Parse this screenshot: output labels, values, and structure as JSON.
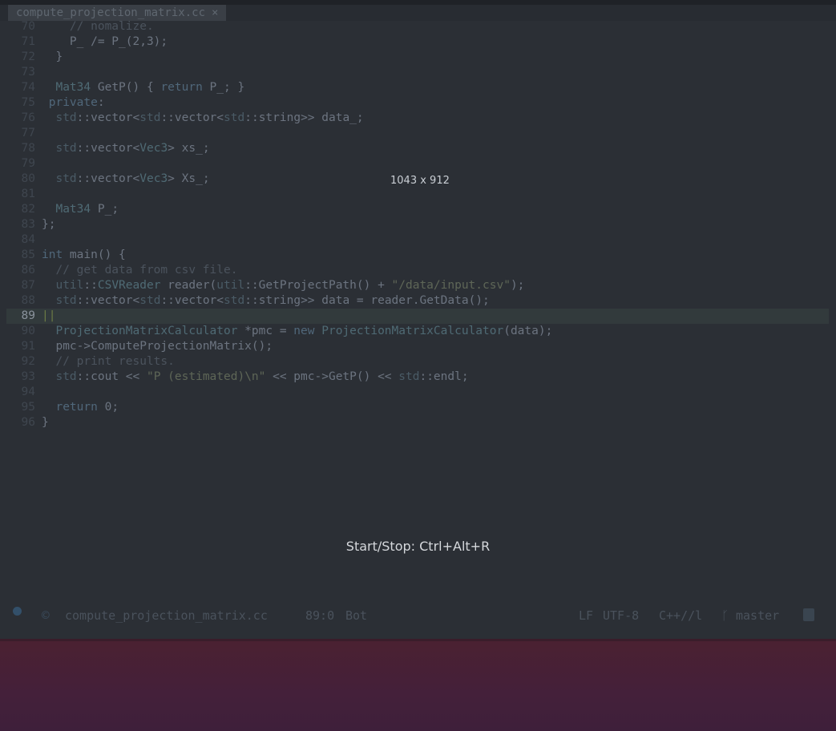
{
  "tab": {
    "filename": "compute_projection_matrix.cc",
    "close": "×"
  },
  "editor": {
    "current_line": 89,
    "lines": [
      {
        "n": "70",
        "html": "    <span class=\"c-com\">// nomalize.</span>"
      },
      {
        "n": "71",
        "html": "    P_ /= P_(2,3);"
      },
      {
        "n": "72",
        "html": "  }"
      },
      {
        "n": "73",
        "html": ""
      },
      {
        "n": "74",
        "html": "  <span class=\"c-type\">Mat34</span> GetP() { <span class=\"c-kw\">return</span> P_; }"
      },
      {
        "n": "75",
        "html": " <span class=\"c-kw\">private</span>:"
      },
      {
        "n": "76",
        "html": "  <span class=\"c-ns\">std</span>::vector&lt;<span class=\"c-ns\">std</span>::vector&lt;<span class=\"c-ns\">std</span>::string&gt;&gt; data_;"
      },
      {
        "n": "77",
        "html": ""
      },
      {
        "n": "78",
        "html": "  <span class=\"c-ns\">std</span>::vector&lt;<span class=\"c-type\">Vec3</span>&gt; xs_;"
      },
      {
        "n": "79",
        "html": ""
      },
      {
        "n": "80",
        "html": "  <span class=\"c-ns\">std</span>::vector&lt;<span class=\"c-type\">Vec3</span>&gt; Xs_;"
      },
      {
        "n": "81",
        "html": ""
      },
      {
        "n": "82",
        "html": "  <span class=\"c-type\">Mat34</span> P_;"
      },
      {
        "n": "83",
        "html": "};"
      },
      {
        "n": "84",
        "html": ""
      },
      {
        "n": "85",
        "html": "<span class=\"c-kw\">int</span> main() {"
      },
      {
        "n": "86",
        "html": "  <span class=\"c-com\">// get data from csv file.</span>"
      },
      {
        "n": "87",
        "html": "  <span class=\"c-ns\">util</span>::<span class=\"c-type\">CSVReader</span> reader(<span class=\"c-ns\">util</span>::GetProjectPath() + <span class=\"c-str\">\"/data/input.csv\"</span>);"
      },
      {
        "n": "88",
        "html": "  <span class=\"c-ns\">std</span>::vector&lt;<span class=\"c-ns\">std</span>::vector&lt;<span class=\"c-ns\">std</span>::string&gt;&gt; data = reader.GetData();"
      },
      {
        "n": "89",
        "html": "<span class=\"cursor-mark\">||</span>"
      },
      {
        "n": "90",
        "html": "  <span class=\"c-type\">ProjectionMatrixCalculator</span> *pmc = <span class=\"c-kw\">new</span> <span class=\"c-type\">ProjectionMatrixCalculator</span>(data);"
      },
      {
        "n": "91",
        "html": "  pmc-&gt;ComputeProjectionMatrix();"
      },
      {
        "n": "92",
        "html": "  <span class=\"c-com\">// print results.</span>"
      },
      {
        "n": "93",
        "html": "  <span class=\"c-ns\">std</span>::cout &lt;&lt; <span class=\"c-str\">\"P (estimated)\\n\"</span> &lt;&lt; pmc-&gt;GetP() &lt;&lt; <span class=\"c-ns\">std</span>::endl;"
      },
      {
        "n": "94",
        "html": ""
      },
      {
        "n": "95",
        "html": "  <span class=\"c-kw\">return</span> 0;"
      },
      {
        "n": "96",
        "html": "}"
      }
    ]
  },
  "overlay": {
    "dimensions": "1043 x 912",
    "start_stop": "Start/Stop: Ctrl+Alt+R"
  },
  "modeline": {
    "filename": "compute_projection_matrix.cc",
    "position": "89:0",
    "scroll": "Bot",
    "eol": "LF",
    "encoding": "UTF-8",
    "mode": "C++//l",
    "branch": "master",
    "icons": {
      "state": "dot-icon",
      "file_type": "cpp-icon",
      "branch": "git-branch-icon",
      "save": "save-icon"
    }
  },
  "colors": {
    "background": "#2b2f35",
    "desktop": "#4b2131"
  }
}
